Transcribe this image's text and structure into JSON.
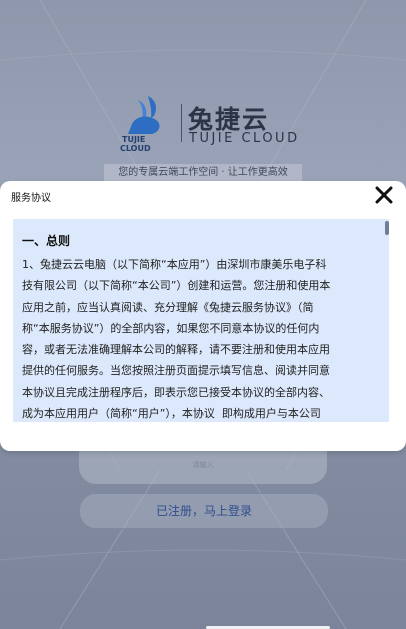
{
  "brand": {
    "name_cn": "兔捷云",
    "name_en": "TUJIE CLOUD",
    "mark_text_1": "TUJIE",
    "mark_text_2": "CLOUD",
    "slogan": "您的专属云端工作空间 · 让工作更高效"
  },
  "modal": {
    "title": "服务协议",
    "close_icon": "close-icon",
    "section_title": "一、总则",
    "body": "1、兔捷云云电脑（以下简称“本应用”）由深圳市康美乐电子科\n技有限公司（以下简称“本公司”）创建和运营。您注册和使用本\n应用之前，应当认真阅读、充分理解《兔捷云服务协议》（简\n称“本服务协议”）的全部内容，如果您不同意本协议的任何内\n容，或者无法准确理解本公司的解释，请不要注册和使用本应用\n提供的任何服务。当您按照注册页面提示填写信息、阅读并同意\n本协议且完成注册程序后，即表示您已接受本协议的全部内容、\n成为本应用用户（简称“用户”），本协议  即构成用户与本公司"
  },
  "form": {
    "input_placeholder": "请输入",
    "login_label": "已注册，马上登录"
  },
  "colors": {
    "background": "#8e97ab",
    "content_bg": "#dce8fb",
    "accent_text": "#2e4d8d",
    "logo_blue": "#2d6ec3"
  }
}
